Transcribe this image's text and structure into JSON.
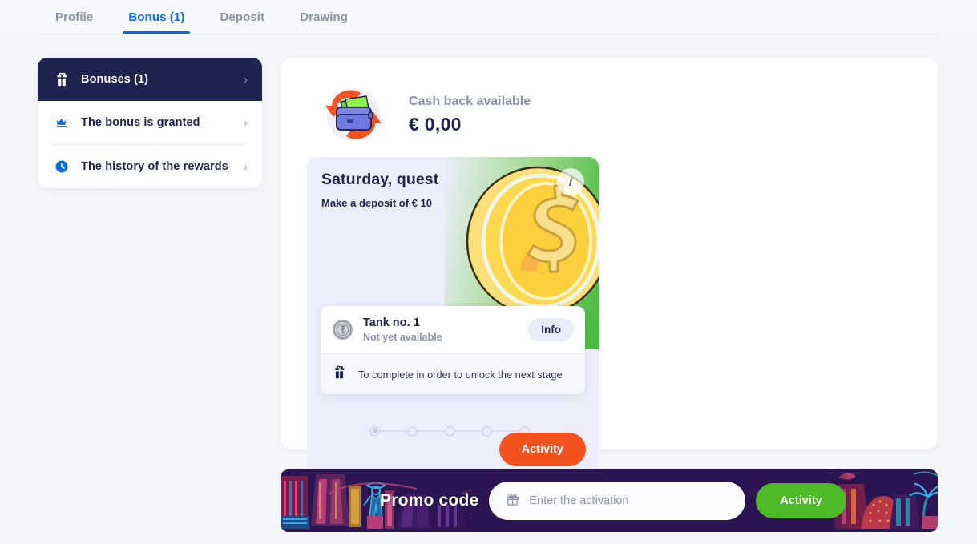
{
  "colors": {
    "accent_blue": "#0d6ce0",
    "navy": "#1e2350",
    "muted": "#8a93a8",
    "orange": "#f4521e",
    "green": "#4cbb27",
    "promo_bg": "#2c1553",
    "page_bg": "#f5f6fa"
  },
  "tabs": [
    {
      "label": "Profile",
      "active": false
    },
    {
      "label": "Bonus (1)",
      "active": true
    },
    {
      "label": "Deposit",
      "active": false
    },
    {
      "label": "Drawing",
      "active": false
    }
  ],
  "sidebar": {
    "items": [
      {
        "label": "Bonuses (1)",
        "icon": "gift-icon",
        "active": true,
        "chevron": "›"
      },
      {
        "label": "The bonus is granted",
        "icon": "crown-icon",
        "active": false,
        "chevron": "›"
      },
      {
        "label": "The history of the rewards",
        "icon": "clock-icon",
        "active": false,
        "chevron": "›"
      }
    ]
  },
  "cashback": {
    "icon": "wallet-refresh-icon",
    "label": "Cash back available",
    "amount": "€ 0,00"
  },
  "quest": {
    "title": "Saturday, quest",
    "subtitle": "Make a deposit of € 10",
    "info_icon_label": "i",
    "art_icon": "gold-coin-icon",
    "tank": {
      "icon": "silver-coin-icon",
      "name": "Tank no. 1",
      "status": "Not yet available",
      "info_button": "Info",
      "footer_icon": "gift-icon",
      "footer_text": "To complete in order to unlock the next stage"
    },
    "progress": {
      "total_steps": 5,
      "current_step": 1
    },
    "activity_button": "Activity"
  },
  "promo": {
    "label": "Promo code",
    "input_icon": "gift-outline-icon",
    "input_value": "",
    "input_placeholder": "Enter the activation",
    "activity_button": "Activity"
  }
}
